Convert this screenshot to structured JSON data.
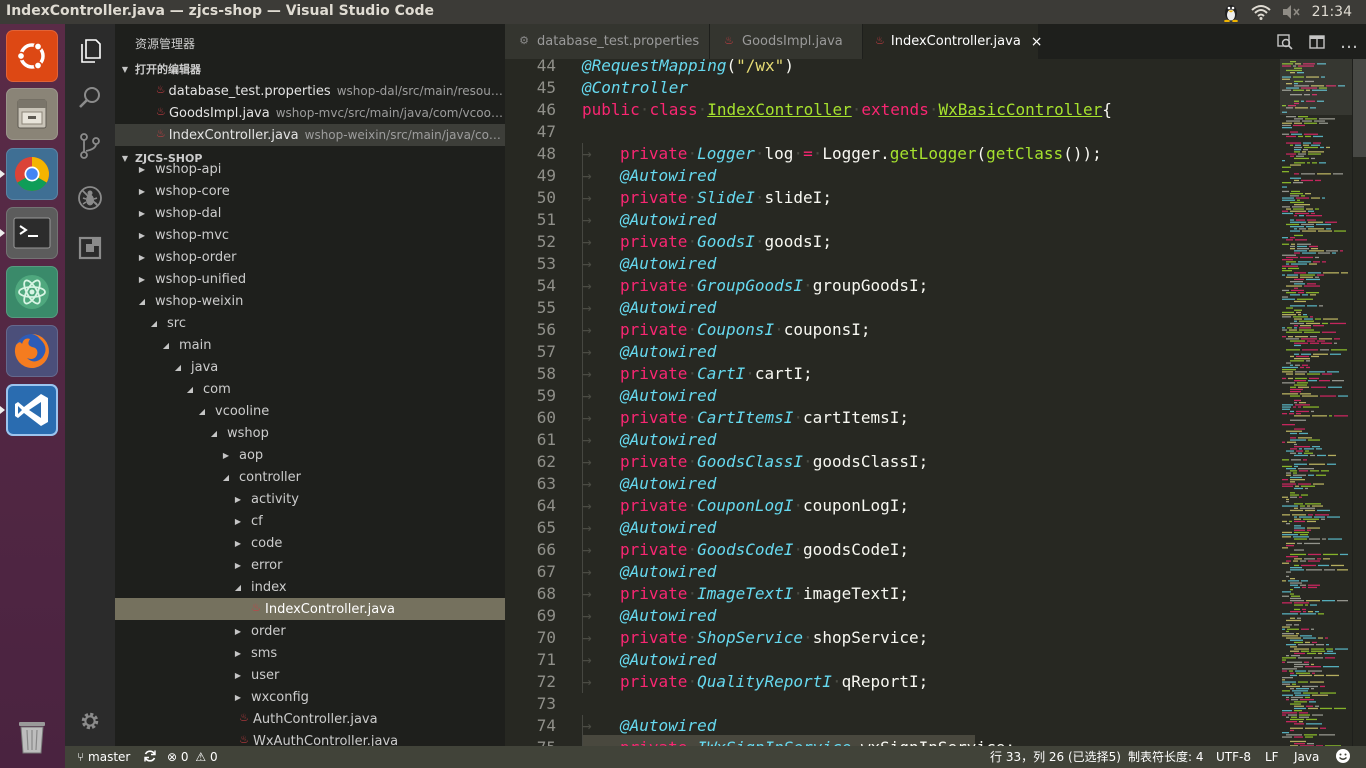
{
  "window": {
    "title": "IndexController.java — zjcs-shop — Visual Studio Code"
  },
  "system": {
    "clock": "21:34"
  },
  "explorer": {
    "title": "资源管理器",
    "open_editors_header": "打开的编辑器",
    "open_editors": [
      {
        "name": "database_test.properties",
        "path": "wshop-dal/src/main/resources/W..."
      },
      {
        "name": "GoodsImpl.java",
        "path": "wshop-mvc/src/main/java/com/vcooline/ws..."
      },
      {
        "name": "IndexController.java",
        "path": "wshop-weixin/src/main/java/com/vcoo..."
      }
    ],
    "project_header": "ZJCS-SHOP",
    "tree": [
      {
        "label": "wshop-api",
        "depth": 0,
        "state": "collapsed"
      },
      {
        "label": "wshop-core",
        "depth": 0,
        "state": "collapsed"
      },
      {
        "label": "wshop-dal",
        "depth": 0,
        "state": "collapsed"
      },
      {
        "label": "wshop-mvc",
        "depth": 0,
        "state": "collapsed"
      },
      {
        "label": "wshop-order",
        "depth": 0,
        "state": "collapsed"
      },
      {
        "label": "wshop-unified",
        "depth": 0,
        "state": "collapsed"
      },
      {
        "label": "wshop-weixin",
        "depth": 0,
        "state": "expanded"
      },
      {
        "label": "src",
        "depth": 1,
        "state": "expanded"
      },
      {
        "label": "main",
        "depth": 2,
        "state": "expanded"
      },
      {
        "label": "java",
        "depth": 3,
        "state": "expanded"
      },
      {
        "label": "com",
        "depth": 4,
        "state": "expanded"
      },
      {
        "label": "vcooline",
        "depth": 5,
        "state": "expanded"
      },
      {
        "label": "wshop",
        "depth": 6,
        "state": "expanded"
      },
      {
        "label": "aop",
        "depth": 7,
        "state": "collapsed"
      },
      {
        "label": "controller",
        "depth": 7,
        "state": "expanded"
      },
      {
        "label": "activity",
        "depth": 8,
        "state": "collapsed"
      },
      {
        "label": "cf",
        "depth": 8,
        "state": "collapsed"
      },
      {
        "label": "code",
        "depth": 8,
        "state": "collapsed"
      },
      {
        "label": "error",
        "depth": 8,
        "state": "collapsed"
      },
      {
        "label": "index",
        "depth": 8,
        "state": "expanded"
      },
      {
        "label": "IndexController.java",
        "depth": 9,
        "state": "file",
        "selected": true
      },
      {
        "label": "order",
        "depth": 8,
        "state": "collapsed"
      },
      {
        "label": "sms",
        "depth": 8,
        "state": "collapsed"
      },
      {
        "label": "user",
        "depth": 8,
        "state": "collapsed"
      },
      {
        "label": "wxconfig",
        "depth": 8,
        "state": "collapsed"
      },
      {
        "label": "AuthController.java",
        "depth": 8,
        "state": "file"
      },
      {
        "label": "WxAuthController.java",
        "depth": 8,
        "state": "file"
      }
    ]
  },
  "tabs": [
    {
      "label": "database_test.properties",
      "active": false
    },
    {
      "label": "GoodsImpl.java",
      "active": false
    },
    {
      "label": "IndexController.java",
      "active": true,
      "close": "×"
    }
  ],
  "editor": {
    "lines": [
      {
        "n": "44",
        "indent": false,
        "tokens": [
          [
            "an",
            "@RequestMapping"
          ],
          [
            "p",
            "("
          ],
          [
            "st",
            "\"/wx\""
          ],
          [
            "p",
            ")"
          ]
        ]
      },
      {
        "n": "45",
        "indent": false,
        "tokens": [
          [
            "an",
            "@Controller"
          ]
        ]
      },
      {
        "n": "46",
        "indent": false,
        "tokens": [
          [
            "kw",
            "public"
          ],
          [
            "ws",
            "·"
          ],
          [
            "kw",
            "class"
          ],
          [
            "ws",
            "·"
          ],
          [
            "cls",
            "IndexController"
          ],
          [
            "ws",
            "·"
          ],
          [
            "kw",
            "extends"
          ],
          [
            "ws",
            "·"
          ],
          [
            "cls",
            "WxBasicController"
          ],
          [
            "p",
            "{"
          ]
        ]
      },
      {
        "n": "47",
        "indent": false,
        "tokens": []
      },
      {
        "n": "48",
        "indent": true,
        "tokens": [
          [
            "kw",
            "private"
          ],
          [
            "ws",
            "·"
          ],
          [
            "ty",
            "Logger"
          ],
          [
            "ws",
            "·"
          ],
          [
            "p",
            "log"
          ],
          [
            "ws",
            "·"
          ],
          [
            "kw",
            "="
          ],
          [
            "ws",
            "·"
          ],
          [
            "p",
            "Logger."
          ],
          [
            "fn",
            "getLogger"
          ],
          [
            "p",
            "("
          ],
          [
            "fn",
            "getClass"
          ],
          [
            "p",
            "());"
          ]
        ]
      },
      {
        "n": "49",
        "indent": true,
        "tokens": [
          [
            "an",
            "@Autowired"
          ]
        ]
      },
      {
        "n": "50",
        "indent": true,
        "tokens": [
          [
            "kw",
            "private"
          ],
          [
            "ws",
            "·"
          ],
          [
            "ty",
            "SlideI"
          ],
          [
            "ws",
            "·"
          ],
          [
            "p",
            "slideI;"
          ]
        ]
      },
      {
        "n": "51",
        "indent": true,
        "tokens": [
          [
            "an",
            "@Autowired"
          ]
        ]
      },
      {
        "n": "52",
        "indent": true,
        "tokens": [
          [
            "kw",
            "private"
          ],
          [
            "ws",
            "·"
          ],
          [
            "ty",
            "GoodsI"
          ],
          [
            "ws",
            "·"
          ],
          [
            "p",
            "goodsI;"
          ]
        ]
      },
      {
        "n": "53",
        "indent": true,
        "tokens": [
          [
            "an",
            "@Autowired"
          ]
        ]
      },
      {
        "n": "54",
        "indent": true,
        "tokens": [
          [
            "kw",
            "private"
          ],
          [
            "ws",
            "·"
          ],
          [
            "ty",
            "GroupGoodsI"
          ],
          [
            "ws",
            "·"
          ],
          [
            "p",
            "groupGoodsI;"
          ]
        ]
      },
      {
        "n": "55",
        "indent": true,
        "tokens": [
          [
            "an",
            "@Autowired"
          ]
        ]
      },
      {
        "n": "56",
        "indent": true,
        "tokens": [
          [
            "kw",
            "private"
          ],
          [
            "ws",
            "·"
          ],
          [
            "ty",
            "CouponsI"
          ],
          [
            "ws",
            "·"
          ],
          [
            "p",
            "couponsI;"
          ]
        ]
      },
      {
        "n": "57",
        "indent": true,
        "tokens": [
          [
            "an",
            "@Autowired"
          ]
        ]
      },
      {
        "n": "58",
        "indent": true,
        "tokens": [
          [
            "kw",
            "private"
          ],
          [
            "ws",
            "·"
          ],
          [
            "ty",
            "CartI"
          ],
          [
            "ws",
            "·"
          ],
          [
            "p",
            "cartI;"
          ]
        ]
      },
      {
        "n": "59",
        "indent": true,
        "tokens": [
          [
            "an",
            "@Autowired"
          ]
        ]
      },
      {
        "n": "60",
        "indent": true,
        "tokens": [
          [
            "kw",
            "private"
          ],
          [
            "ws",
            "·"
          ],
          [
            "ty",
            "CartItemsI"
          ],
          [
            "ws",
            "·"
          ],
          [
            "p",
            "cartItemsI;"
          ]
        ]
      },
      {
        "n": "61",
        "indent": true,
        "tokens": [
          [
            "an",
            "@Autowired"
          ]
        ]
      },
      {
        "n": "62",
        "indent": true,
        "tokens": [
          [
            "kw",
            "private"
          ],
          [
            "ws",
            "·"
          ],
          [
            "ty",
            "GoodsClassI"
          ],
          [
            "ws",
            "·"
          ],
          [
            "p",
            "goodsClassI;"
          ]
        ]
      },
      {
        "n": "63",
        "indent": true,
        "tokens": [
          [
            "an",
            "@Autowired"
          ]
        ]
      },
      {
        "n": "64",
        "indent": true,
        "tokens": [
          [
            "kw",
            "private"
          ],
          [
            "ws",
            "·"
          ],
          [
            "ty",
            "CouponLogI"
          ],
          [
            "ws",
            "·"
          ],
          [
            "p",
            "couponLogI;"
          ]
        ]
      },
      {
        "n": "65",
        "indent": true,
        "tokens": [
          [
            "an",
            "@Autowired"
          ]
        ]
      },
      {
        "n": "66",
        "indent": true,
        "tokens": [
          [
            "kw",
            "private"
          ],
          [
            "ws",
            "·"
          ],
          [
            "ty",
            "GoodsCodeI"
          ],
          [
            "ws",
            "·"
          ],
          [
            "p",
            "goodsCodeI;"
          ]
        ]
      },
      {
        "n": "67",
        "indent": true,
        "tokens": [
          [
            "an",
            "@Autowired"
          ]
        ]
      },
      {
        "n": "68",
        "indent": true,
        "tokens": [
          [
            "kw",
            "private"
          ],
          [
            "ws",
            "·"
          ],
          [
            "ty",
            "ImageTextI"
          ],
          [
            "ws",
            "·"
          ],
          [
            "p",
            "imageTextI;"
          ]
        ]
      },
      {
        "n": "69",
        "indent": true,
        "tokens": [
          [
            "an",
            "@Autowired"
          ]
        ]
      },
      {
        "n": "70",
        "indent": true,
        "tokens": [
          [
            "kw",
            "private"
          ],
          [
            "ws",
            "·"
          ],
          [
            "ty",
            "ShopService"
          ],
          [
            "ws",
            "·"
          ],
          [
            "p",
            "shopService;"
          ]
        ]
      },
      {
        "n": "71",
        "indent": true,
        "tokens": [
          [
            "an",
            "@Autowired"
          ]
        ]
      },
      {
        "n": "72",
        "indent": true,
        "tokens": [
          [
            "kw",
            "private"
          ],
          [
            "ws",
            "·"
          ],
          [
            "ty",
            "QualityReportI"
          ],
          [
            "ws",
            "·"
          ],
          [
            "p",
            "qReportI;"
          ]
        ]
      },
      {
        "n": "73",
        "indent": false,
        "tokens": []
      },
      {
        "n": "74",
        "indent": true,
        "tokens": [
          [
            "an",
            "@Autowired"
          ]
        ]
      },
      {
        "n": "75",
        "indent": true,
        "tokens": [
          [
            "kw",
            "private"
          ],
          [
            "ws",
            "·"
          ],
          [
            "ty",
            "IWxSignInService"
          ],
          [
            "ws",
            "·"
          ],
          [
            "p",
            "wxSignInService;"
          ]
        ]
      }
    ]
  },
  "statusbar": {
    "branch": "master",
    "errors": "0",
    "warnings": "0",
    "position": "行 33，列 26 (已选择5)",
    "tab_size": "制表符长度: 4",
    "encoding": "UTF-8",
    "eol": "LF",
    "language": "Java"
  },
  "colors": {
    "editor_bg": "#272822",
    "sidebar_bg": "#1e1f1c",
    "status_bg": "#414339",
    "keyword": "#f92672",
    "type": "#66d9ef",
    "class": "#a6e22e",
    "string": "#e6db74",
    "launcher": "#4a2340"
  },
  "icons": {
    "launcher": [
      "ubuntu-dash-icon",
      "files-icon",
      "chrome-icon",
      "terminal-icon",
      "atom-icon",
      "firefox-icon",
      "vscode-icon",
      "trash-icon"
    ],
    "activity": [
      "explorer-icon",
      "search-icon",
      "git-icon",
      "debug-icon",
      "extensions-icon",
      "settings-gear-icon"
    ],
    "tray": [
      "tux-icon",
      "wifi-icon",
      "volume-muted-icon"
    ]
  }
}
